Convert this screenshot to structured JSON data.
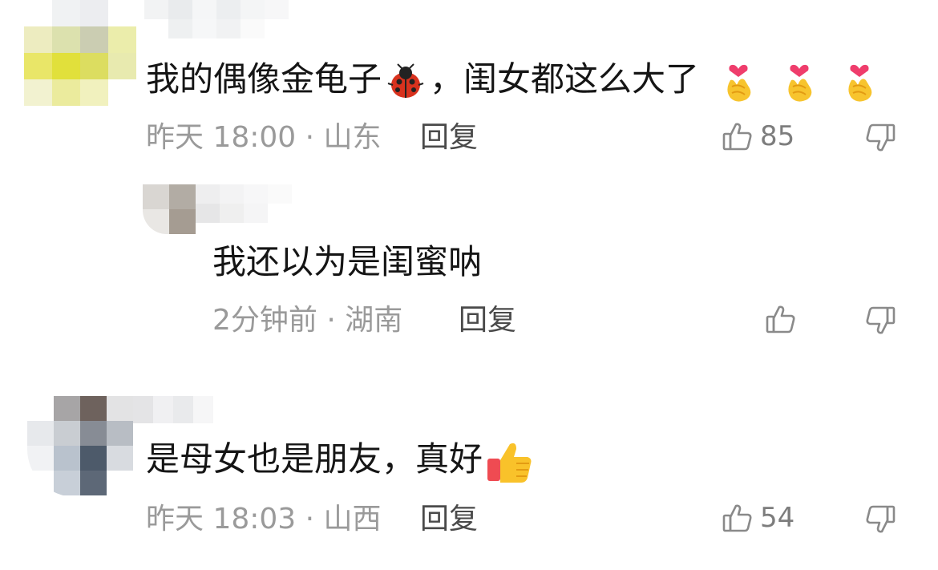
{
  "comments": [
    {
      "text": "我的偶像金龟子",
      "text_emoji": "ladybug-emoji",
      "text_after": "，闺女都这么大了",
      "trailing_emoji": "finger-heart-emoji",
      "time": "昨天 18:00 · 山东",
      "reply_label": "回复",
      "likes": "85"
    },
    {
      "text": "我还以为是闺蜜呐",
      "time": "2分钟前 · 湖南",
      "reply_label": "回复",
      "likes": ""
    },
    {
      "text": "是母女也是朋友，真好",
      "trailing_emoji": "thumbs-up-emoji",
      "time": "昨天 18:03 · 山西",
      "reply_label": "回复",
      "likes": "54"
    }
  ],
  "colors": {
    "meta_gray": "#9a9a9a",
    "reply_gray": "#4a4a4a",
    "text": "#151515"
  }
}
